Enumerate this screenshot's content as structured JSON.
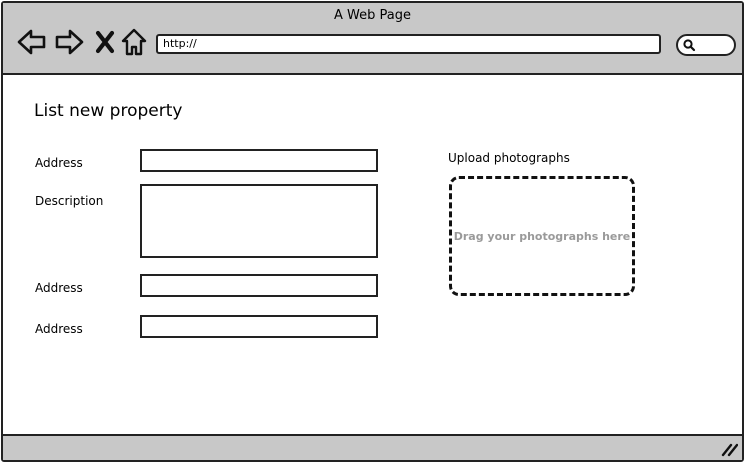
{
  "window": {
    "title": "A Web Page"
  },
  "browser": {
    "url": "http://",
    "icons": [
      "back-icon",
      "forward-icon",
      "close-icon",
      "home-icon",
      "search-icon"
    ]
  },
  "page": {
    "title": "List new property",
    "fields": [
      {
        "label": "Address",
        "value": ""
      },
      {
        "label": "Description",
        "value": ""
      },
      {
        "label": "Address",
        "value": ""
      },
      {
        "label": "Address",
        "value": ""
      }
    ],
    "upload": {
      "label": "Upload photographs",
      "dropzone_text": "Drag your photographs here"
    }
  },
  "colors": {
    "chrome": "#c8c8c8",
    "outline": "#222222",
    "placeholder_text": "#9a9a9a"
  }
}
